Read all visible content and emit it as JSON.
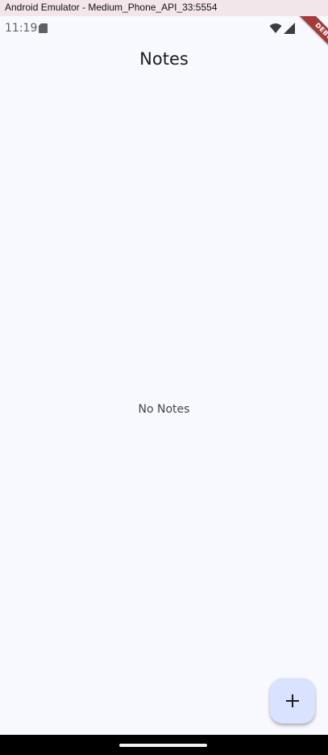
{
  "window": {
    "title": "Android Emulator - Medium_Phone_API_33:5554"
  },
  "status_bar": {
    "time": "11:19",
    "icons": [
      "sd-card-icon",
      "wifi-icon",
      "signal-icon"
    ]
  },
  "debug_banner": {
    "label": "DEBUG",
    "color": "#a33b3b"
  },
  "app_bar": {
    "title": "Notes"
  },
  "content": {
    "empty_message": "No Notes"
  },
  "fab": {
    "icon": "add-icon",
    "color": "#d9e2ff"
  },
  "colors": {
    "background": "#f8f9ff",
    "titlebar": "#f3e6ea",
    "nav_bar": "#000000"
  }
}
